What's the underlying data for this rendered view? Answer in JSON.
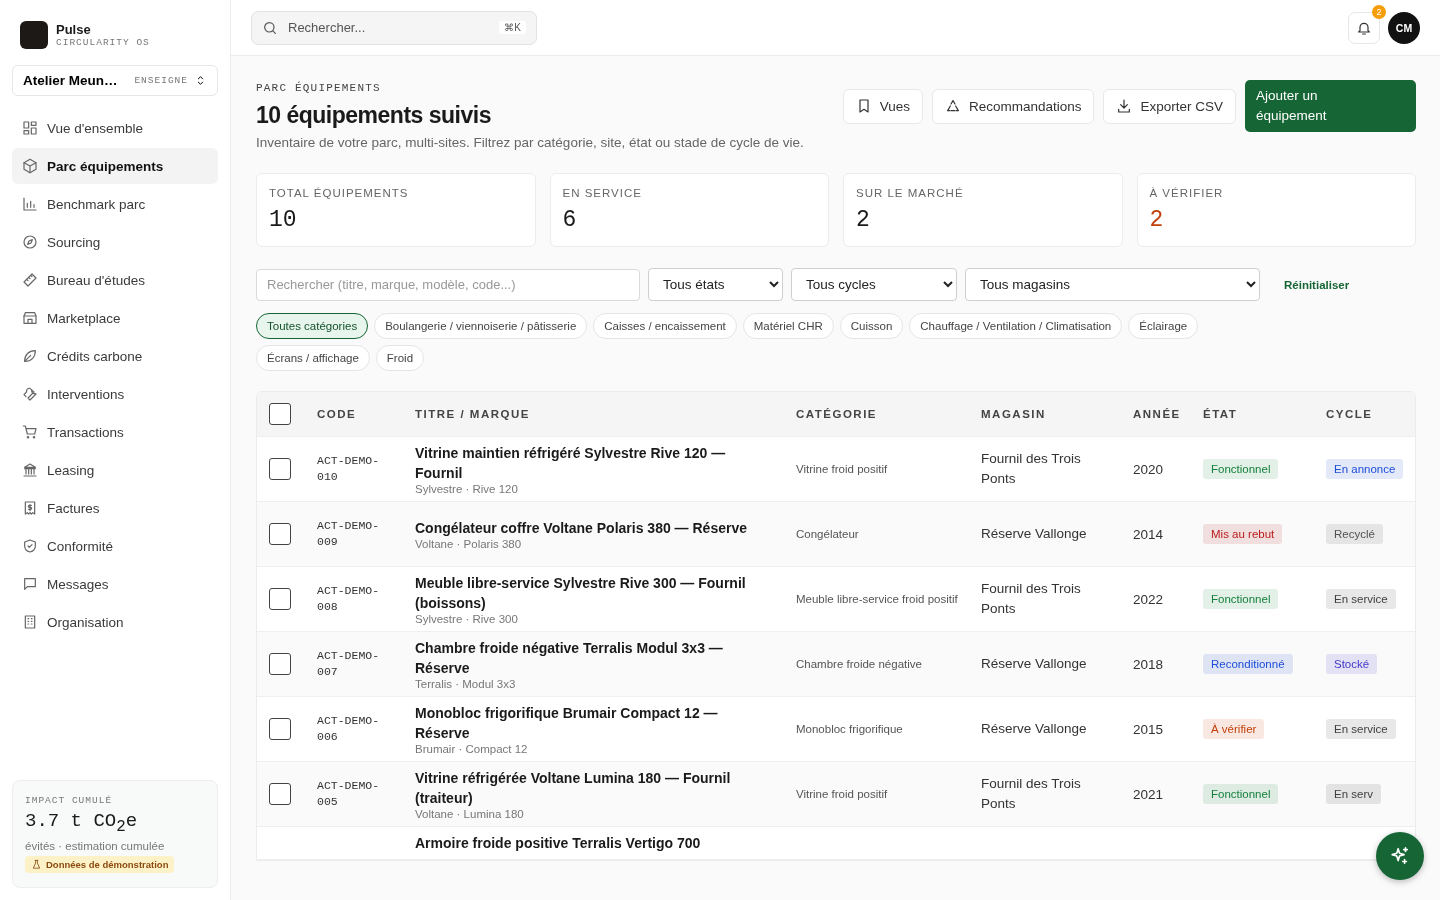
{
  "brand": {
    "name": "Pulse",
    "tagline": "CIRCULARITY OS"
  },
  "org_switcher": {
    "name": "Atelier Meun…",
    "badge": "ENSEIGNE"
  },
  "sidebar": {
    "items": [
      {
        "label": "Vue d'ensemble",
        "selected": false
      },
      {
        "label": "Parc équipements",
        "selected": true
      },
      {
        "label": "Benchmark parc",
        "selected": false
      },
      {
        "label": "Sourcing",
        "selected": false
      },
      {
        "label": "Bureau d'études",
        "selected": false
      },
      {
        "label": "Marketplace",
        "selected": false
      },
      {
        "label": "Crédits carbone",
        "selected": false
      },
      {
        "label": "Interventions",
        "selected": false
      },
      {
        "label": "Transactions",
        "selected": false
      },
      {
        "label": "Leasing",
        "selected": false
      },
      {
        "label": "Factures",
        "selected": false
      },
      {
        "label": "Conformité",
        "selected": false
      },
      {
        "label": "Messages",
        "selected": false
      },
      {
        "label": "Organisation",
        "selected": false
      }
    ]
  },
  "impact": {
    "label": "IMPACT CUMULÉ",
    "value": "3.7 t CO$_{2}$e",
    "caption": "évités · estimation cumulée",
    "badge": "Données de démonstration"
  },
  "topbar": {
    "search": {
      "placeholder": "Rechercher...",
      "shortcut": "⌘K"
    },
    "notifications": "2",
    "avatar": "CM"
  },
  "header": {
    "eyebrow": "PARC ÉQUIPEMENTS",
    "title": "10 équipements suivis",
    "subtitle": "Inventaire de votre parc, multi-sites. Filtrez par catégorie, site, état ou stade de cycle de vie.",
    "actions": [
      "Vues",
      "Recommandations",
      "Exporter CSV"
    ],
    "primary": "Ajouter un équipement"
  },
  "stats": [
    {
      "label": "TOTAL ÉQUIPEMENTS",
      "value": "10",
      "color": "#1a1a1a"
    },
    {
      "label": "EN SERVICE",
      "value": "6",
      "color": "#1a1a1a"
    },
    {
      "label": "SUR LE MARCHÉ",
      "value": "2",
      "color": "#1a1a1a"
    },
    {
      "label": "À VÉRIFIER",
      "value": "2",
      "color": "#c2410c"
    }
  ],
  "filters": {
    "search": {
      "placeholder": "Rechercher (titre, marque, modèle, code...)"
    },
    "selects": [
      "Tous états",
      "Tous cycles",
      "Tous magasins"
    ],
    "reset": "Réinitialiser"
  },
  "categories": [
    {
      "label": "Toutes catégories",
      "selected": true
    },
    {
      "label": "Boulangerie / viennoiserie / pâtisserie",
      "selected": false
    },
    {
      "label": "Caisses / encaissement",
      "selected": false
    },
    {
      "label": "Matériel CHR",
      "selected": false
    },
    {
      "label": "Cuisson",
      "selected": false
    },
    {
      "label": "Chauffage / Ventilation / Climatisation",
      "selected": false
    },
    {
      "label": "Éclairage",
      "selected": false
    },
    {
      "label": "Écrans / affichage",
      "selected": false
    },
    {
      "label": "Froid",
      "selected": false
    }
  ],
  "table": {
    "select_all": {
      "checked": false
    },
    "columns": [
      "CODE",
      "TITRE / MARQUE",
      "CATÉGORIE",
      "MAGASIN",
      "ANNÉE",
      "ÉTAT",
      "CYCLE"
    ],
    "rows": [
      {
        "checked": false,
        "code": "ACT-DEMO-010",
        "title": "Vitrine maintien réfrigéré Sylvestre Rive 120 — Fournil",
        "brand": "Sylvestre · Rive 120",
        "category": "Vitrine froid positif",
        "store": "Fournil des Trois Ponts",
        "year": "2020",
        "state": {
          "label": "Fonctionnel",
          "color": "#15803d"
        },
        "cycle": {
          "label": "En annonce",
          "color": "#1d4ed8"
        }
      },
      {
        "checked": false,
        "code": "ACT-DEMO-009",
        "title": "Congélateur coffre Voltane Polaris 380 — Réserve",
        "brand": "Voltane · Polaris 380",
        "category": "Congélateur",
        "store": "Réserve Vallonge",
        "year": "2014",
        "state": {
          "label": "Mis au rebut",
          "color": "#b91c1c"
        },
        "cycle": {
          "label": "Recyclé",
          "color": "#525252"
        }
      },
      {
        "checked": false,
        "code": "ACT-DEMO-008",
        "title": "Meuble libre-service Sylvestre Rive 300 — Fournil (boissons)",
        "brand": "Sylvestre · Rive 300",
        "category": "Meuble libre-service froid positif",
        "store": "Fournil des Trois Ponts",
        "year": "2022",
        "state": {
          "label": "Fonctionnel",
          "color": "#15803d"
        },
        "cycle": {
          "label": "En service",
          "color": "#404040"
        }
      },
      {
        "checked": false,
        "code": "ACT-DEMO-007",
        "title": "Chambre froide négative Terralis Modul 3x3 — Réserve",
        "brand": "Terralis · Modul 3x3",
        "category": "Chambre froide négative",
        "store": "Réserve Vallonge",
        "year": "2018",
        "state": {
          "label": "Reconditionné",
          "color": "#1d4ed8"
        },
        "cycle": {
          "label": "Stocké",
          "color": "#4338ca"
        }
      },
      {
        "checked": false,
        "code": "ACT-DEMO-006",
        "title": "Monobloc frigorifique Brumair Compact 12 — Réserve",
        "brand": "Brumair · Compact 12",
        "category": "Monobloc frigorifique",
        "store": "Réserve Vallonge",
        "year": "2015",
        "state": {
          "label": "À vérifier",
          "color": "#c2410c"
        },
        "cycle": {
          "label": "En service",
          "color": "#404040"
        }
      },
      {
        "checked": false,
        "code": "ACT-DEMO-005",
        "title": "Vitrine réfrigérée Voltane Lumina 180 — Fournil (traiteur)",
        "brand": "Voltane · Lumina 180",
        "category": "Vitrine froid positif",
        "store": "Fournil des Trois Ponts",
        "year": "2021",
        "state": {
          "label": "Fonctionnel",
          "color": "#15803d"
        },
        "cycle": {
          "label": "En serv",
          "color": "#404040"
        }
      },
      {
        "title": "Armoire froide positive Terralis Vertigo 700"
      }
    ]
  }
}
